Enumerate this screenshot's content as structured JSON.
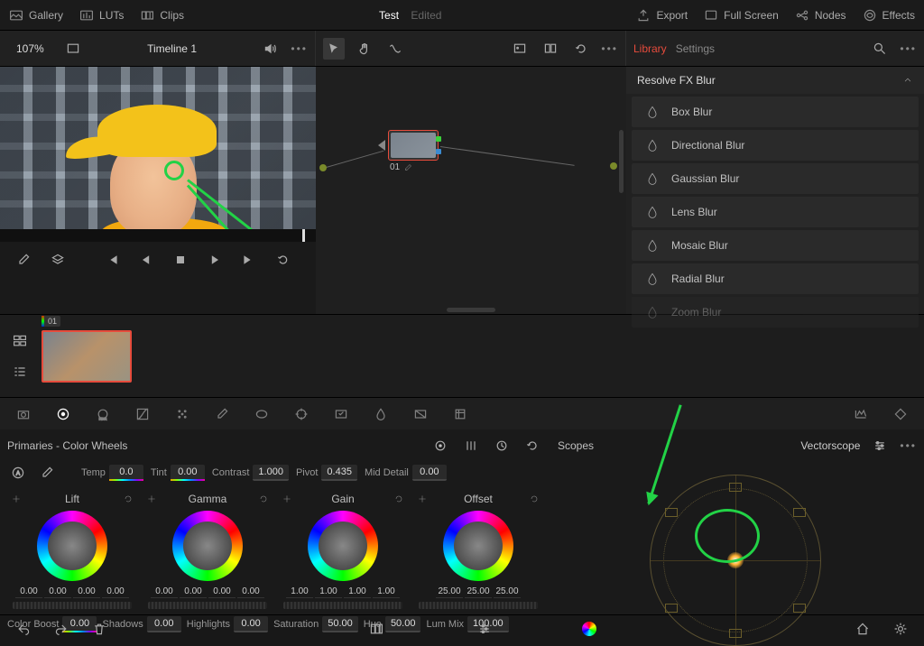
{
  "top": {
    "gallery": "Gallery",
    "luts": "LUTs",
    "clips": "Clips",
    "project": "Test",
    "edited": "Edited",
    "export": "Export",
    "fullscreen": "Full Screen",
    "nodes": "Nodes",
    "effects": "Effects"
  },
  "viewer": {
    "zoom": "107%",
    "timeline": "Timeline 1"
  },
  "lib": {
    "tab_library": "Library",
    "tab_settings": "Settings",
    "category": "Resolve FX Blur",
    "items": [
      "Box Blur",
      "Directional Blur",
      "Gaussian Blur",
      "Lens Blur",
      "Mosaic Blur",
      "Radial Blur",
      "Zoom Blur"
    ]
  },
  "node": {
    "num": "01"
  },
  "clip": {
    "badge": "01"
  },
  "primaries": {
    "title": "Primaries - Color Wheels",
    "temp_l": "Temp",
    "temp_v": "0.0",
    "tint_l": "Tint",
    "tint_v": "0.00",
    "contrast_l": "Contrast",
    "contrast_v": "1.000",
    "pivot_l": "Pivot",
    "pivot_v": "0.435",
    "md_l": "Mid Detail",
    "md_v": "0.00",
    "wheels": [
      {
        "name": "Lift",
        "nums": [
          "0.00",
          "0.00",
          "0.00",
          "0.00"
        ]
      },
      {
        "name": "Gamma",
        "nums": [
          "0.00",
          "0.00",
          "0.00",
          "0.00"
        ]
      },
      {
        "name": "Gain",
        "nums": [
          "1.00",
          "1.00",
          "1.00",
          "1.00"
        ]
      },
      {
        "name": "Offset",
        "nums": [
          "25.00",
          "25.00",
          "25.00"
        ]
      }
    ],
    "cb_l": "Color Boost",
    "cb_v": "0.00",
    "sh_l": "Shadows",
    "sh_v": "0.00",
    "hl_l": "Highlights",
    "hl_v": "0.00",
    "sat_l": "Saturation",
    "sat_v": "50.00",
    "hue_l": "Hue",
    "hue_v": "50.00",
    "lm_l": "Lum Mix",
    "lm_v": "100.00"
  },
  "scopes": {
    "title": "Scopes",
    "type": "Vectorscope"
  }
}
